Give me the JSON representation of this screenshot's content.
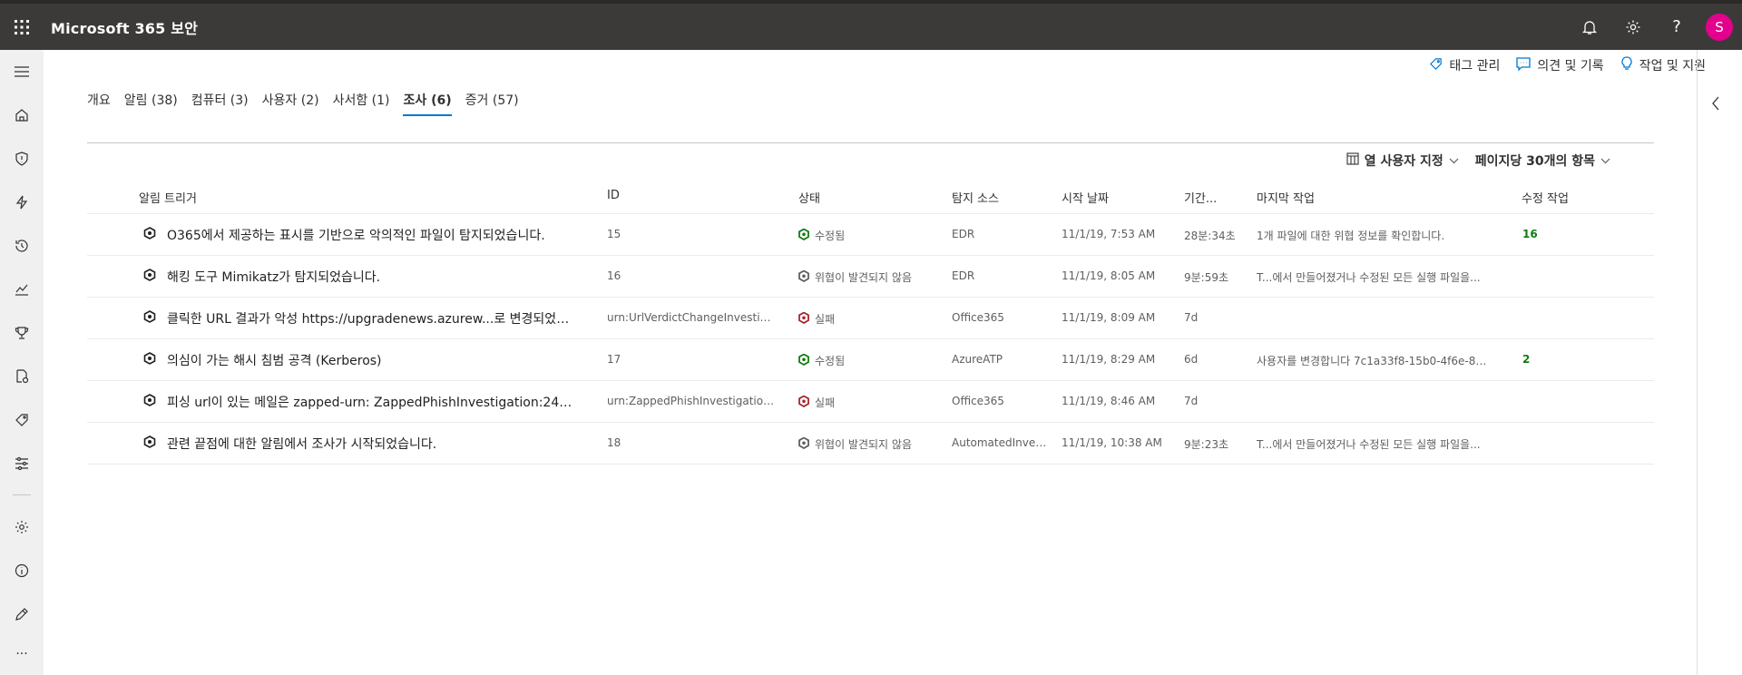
{
  "header": {
    "title": "Microsoft 365 보안",
    "avatar_initial": "S",
    "actions": [
      "bell-icon",
      "gear-icon",
      "help-icon"
    ],
    "help_glyph": "?"
  },
  "leftnav": {
    "items": [
      "menu-icon",
      "home-icon",
      "shield-icon",
      "lightning-icon",
      "history-icon",
      "chart-icon",
      "trophy-icon",
      "policy-icon",
      "tag-icon",
      "sliders-icon",
      "settings-icon",
      "info-icon",
      "pen-icon",
      "more-icon"
    ],
    "more_glyph": "···"
  },
  "commands": {
    "tags": "태그 관리",
    "comments": "의견 및 기록",
    "actions": "작업 및 지원"
  },
  "tabs": [
    {
      "label": "개요"
    },
    {
      "label": "알림 (38)"
    },
    {
      "label": "컴퓨터 (3)"
    },
    {
      "label": "사용자 (2)"
    },
    {
      "label": "사서함 (1)"
    },
    {
      "label": "조사 (6)",
      "active": true
    },
    {
      "label": "증거 (57)"
    }
  ],
  "toolbar": {
    "columns": "열 사용자 지정",
    "page_size": "페이지당 30개의 항목"
  },
  "table": {
    "headers": {
      "trigger": "알림 트리거",
      "id": "ID",
      "status": "상태",
      "source": "탐지 소스",
      "start": "시작 날짜",
      "duration": "기간...",
      "last": "마지막 작업",
      "fix": "수정 작업"
    },
    "rows": [
      {
        "trigger": "O365에서 제공하는 표시를 기반으로 악의적인 파일이 탐지되었습니다.",
        "id": "15",
        "status": "수정됨",
        "status_color": "#107c10",
        "source": "EDR",
        "start": "11/1/19, 7:53 AM",
        "duration": "28분:34초",
        "last": "1개 파일에 대한 위협 정보를 확인합니다.",
        "fix": "16"
      },
      {
        "trigger": "해킹 도구 Mimikatz가 탐지되었습니다.",
        "id": "16",
        "status": "위협이 발견되지 않음",
        "status_color": "#605e5c",
        "source": "EDR",
        "start": "11/1/19, 8:05 AM",
        "duration": "9분:59초",
        "last": "T...에서 만들어졌거나 수정된 모든 실행 파일을...",
        "fix": ""
      },
      {
        "trigger": "클릭한 URL 결과가 악성 https://upgradenews.azurew...로 변경되었습니다.",
        "id": "urn:UrlVerdictChangeInvestig:7a...",
        "status": "실패",
        "status_color": "#a4262c",
        "source": "Office365",
        "start": "11/1/19, 8:09 AM",
        "duration": "7d",
        "last": "",
        "fix": ""
      },
      {
        "trigger": "의심이 가는 해시 침범 공격 (Kerberos)",
        "id": "17",
        "status": "수정됨",
        "status_color": "#107c10",
        "source": "AzureATP",
        "start": "11/1/19, 8:29 AM",
        "duration": "6d",
        "last": "사용자를 변경합니다 7c1a33f8-15b0-4f6e-842...",
        "fix": "2"
      },
      {
        "trigger": "피싱 url이 있는 메일은 zapped-urn: ZappedPhishInvestigation:24d4d8c...",
        "id": "urn:ZappedPhishInvestigation:2...",
        "status": "실패",
        "status_color": "#a4262c",
        "source": "Office365",
        "start": "11/1/19, 8:46 AM",
        "duration": "7d",
        "last": "",
        "fix": ""
      },
      {
        "trigger": "관련 끝점에 대한 알림에서 조사가 시작되었습니다.",
        "id": "18",
        "status": "위협이 발견되지 않음",
        "status_color": "#605e5c",
        "source": "AutomatedInvesti...",
        "start": "11/1/19, 10:38 AM",
        "duration": "9분:23초",
        "last": "T...에서 만들어졌거나 수정된 모든 실행 파일을...",
        "fix": ""
      }
    ]
  }
}
